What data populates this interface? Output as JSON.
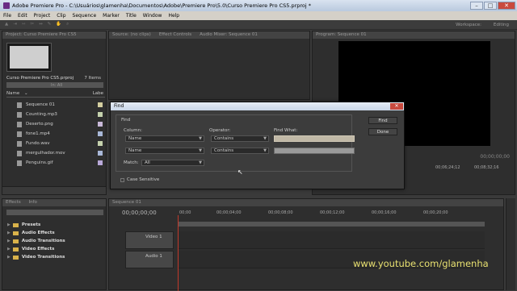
{
  "window": {
    "title": "Adobe Premiere Pro - C:\\Usuários\\glamenha\\Documentos\\Adobe\\Premiere Pro\\5.0\\Curso Premiere Pro CS5.prproj *"
  },
  "menu": [
    "File",
    "Edit",
    "Project",
    "Clip",
    "Sequence",
    "Marker",
    "Title",
    "Window",
    "Help"
  ],
  "toolbar": {
    "workspace_label": "Workspace:",
    "workspace_value": "Editing"
  },
  "project": {
    "tab": "Project: Curso Premiere Pro CS5",
    "name": "Curso Premiere Pro CS5.prproj",
    "items_count": "7 Items",
    "in_label": "In:",
    "in_value": "All",
    "col_name": "Name",
    "col_label": "Labe",
    "files": [
      {
        "name": "Sequence 01",
        "color": "#d4cfa0"
      },
      {
        "name": "Counting.mp3",
        "color": "#c5d2ad"
      },
      {
        "name": "Deserto.png",
        "color": "#c9b9d9"
      },
      {
        "name": "fone1.mp4",
        "color": "#a9b8d8"
      },
      {
        "name": "Fundo.wav",
        "color": "#c5d2ad"
      },
      {
        "name": "mergulhador.mov",
        "color": "#a9b8d8"
      },
      {
        "name": "Penguins.gif",
        "color": "#b9a9d9"
      }
    ]
  },
  "source": {
    "tabs": [
      "Source: (no clips)",
      "Effect Controls",
      "Audio Mixer: Sequence 01"
    ]
  },
  "program": {
    "tab": "Program: Sequence 01",
    "timecode": "00;00;00;00",
    "ruler": [
      "00;06;24;12",
      "00;08;32;16"
    ]
  },
  "effects": {
    "tabs": [
      "Effects",
      "Info"
    ],
    "items": [
      "Presets",
      "Audio Effects",
      "Audio Transitions",
      "Video Effects",
      "Video Transitions"
    ]
  },
  "timeline": {
    "tab": "Sequence 01",
    "timecode": "00;00;00;00",
    "ruler": [
      "00;00",
      "00;00;04;00",
      "00;00;08;00",
      "00;00;12;00",
      "00;00;16;00",
      "00;00;20;00"
    ],
    "tracks": [
      "Video 1",
      "Audio 1"
    ]
  },
  "dialog": {
    "title": "Find",
    "group": "Find",
    "column_label": "Column:",
    "operator_label": "Operator:",
    "find_what_label": "Find What:",
    "row1": {
      "column": "Name",
      "operator": "Contains"
    },
    "row2": {
      "column": "Name",
      "operator": "Contains"
    },
    "match_label": "Match:",
    "match_value": "All",
    "case_sensitive": "Case Sensitive",
    "find_button": "Find",
    "done_button": "Done"
  },
  "watermark": "www.youtube.com/glamenha"
}
